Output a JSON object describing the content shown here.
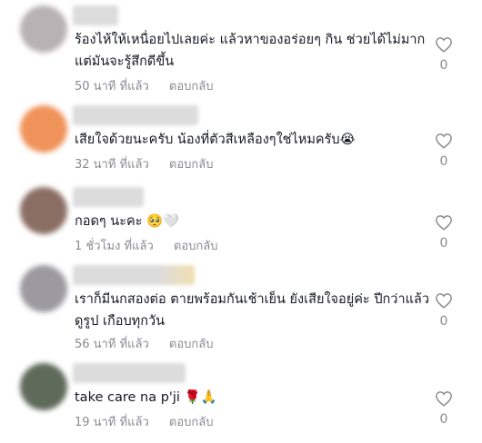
{
  "comments": [
    {
      "text": "ร้องไห้ให้เหนื่อยไปเลยค่ะ แล้วหาของอร่อยๆ กิน ช่วยได้ไม่มาก แต่มันจะรู้สึกดีขึ้น",
      "time": "50 นาที ที่แล้ว",
      "reply": "ตอบกลับ",
      "likes": "0",
      "avatar_color": "#b9b2b4"
    },
    {
      "text": "เสียใจด้วยนะครับ น้องที่ตัวสีเหลืองๆใช่ไหมครับ😭",
      "time": "32 นาที ที่แล้ว",
      "reply": "ตอบกลับ",
      "likes": "0",
      "avatar_color": "#f0935a"
    },
    {
      "text": "กอดๆ นะคะ 🥺🤍",
      "time": "1 ชั่วโมง ที่แล้ว",
      "reply": "ตอบกลับ",
      "likes": "0",
      "avatar_color": "#8a6e64"
    },
    {
      "text": "เราก็มีนกสองต่อ ตายพร้อมกันเช้าเย็น ยังเสียใจอยู่ค่ะ ปีกว่าแล้ว ดูรูป เกือบทุกวัน",
      "time": "56 นาที ที่แล้ว",
      "reply": "ตอบกลับ",
      "likes": "0",
      "avatar_color": "#9c9aa0"
    },
    {
      "text": "take care na p'ji 🌹🙏",
      "time": "19 นาที ที่แล้ว",
      "reply": "ตอบกลับ",
      "likes": "0",
      "avatar_color": "#5e6a5a"
    }
  ]
}
